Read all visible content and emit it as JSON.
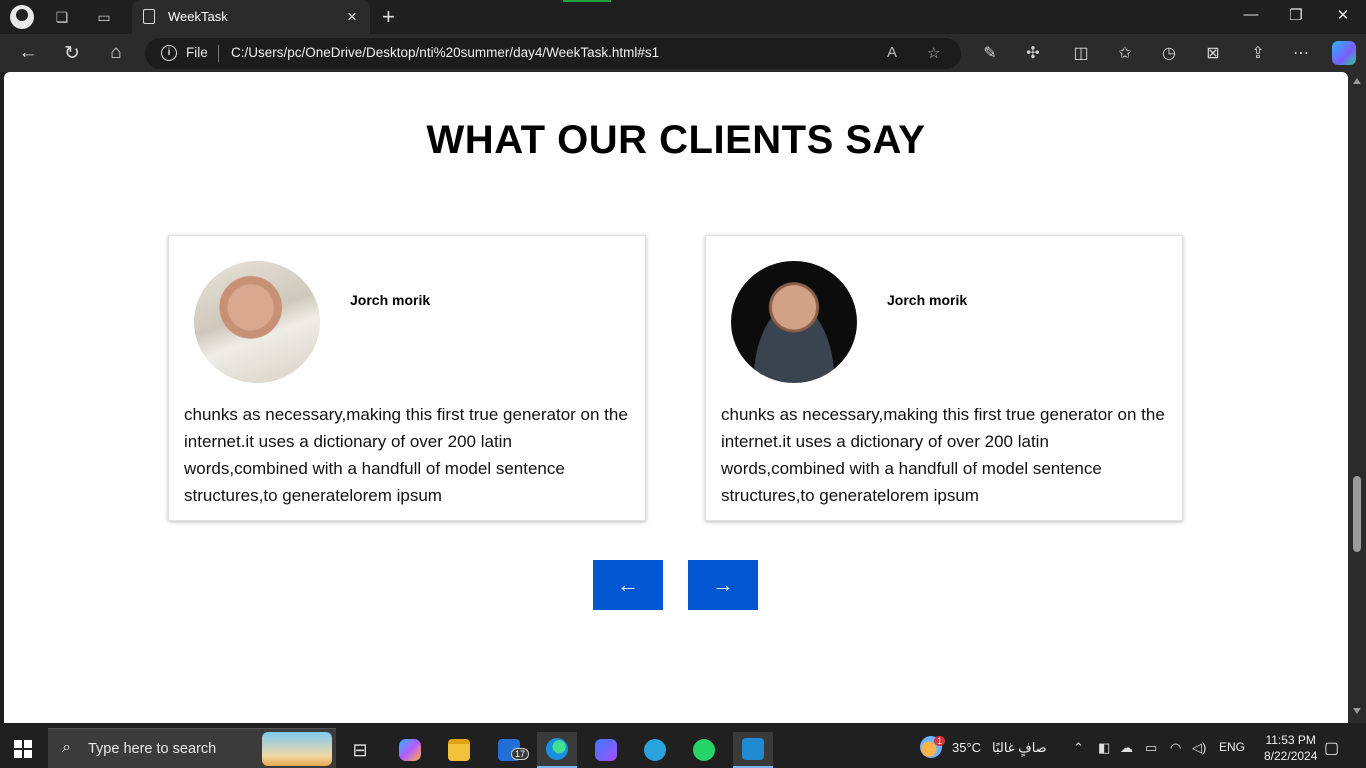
{
  "browser": {
    "tab_title": "WeekTask",
    "new_tab": "+",
    "address": {
      "scheme_label": "File",
      "url": "C:/Users/pc/OneDrive/Desktop/nti%20summer/day4/WeekTask.html#s1"
    },
    "window_controls": {
      "minimize": "—",
      "restore": "❐",
      "close": "✕"
    }
  },
  "page": {
    "section_title": "WHAT OUR CLIENTS SAY",
    "testimonials": [
      {
        "name": "Jorch morik",
        "text": "chunks as necessary,making this first true generator on the internet.it uses a dictionary of over 200 latin words,combined with a handfull of model sentence structures,to generatelorem ipsum"
      },
      {
        "name": "Jorch morik",
        "text": "chunks as necessary,making this first true generator on the internet.it uses a dictionary of over 200 latin words,combined with a handfull of model sentence structures,to generatelorem ipsum"
      }
    ],
    "prev_arrow": "←",
    "next_arrow": "→"
  },
  "taskbar": {
    "search_placeholder": "Type here to search",
    "mail_badge": "17",
    "weather_badge": "1",
    "temperature": "35°C",
    "weather_text": "صافٍ غالبًا",
    "language": "ENG",
    "time": "11:53 PM",
    "date": "8/22/2024"
  },
  "colors": {
    "accent_button": "#0057d1",
    "chrome_dark": "#1f1f1f",
    "toolbar": "#2b2b2b"
  }
}
